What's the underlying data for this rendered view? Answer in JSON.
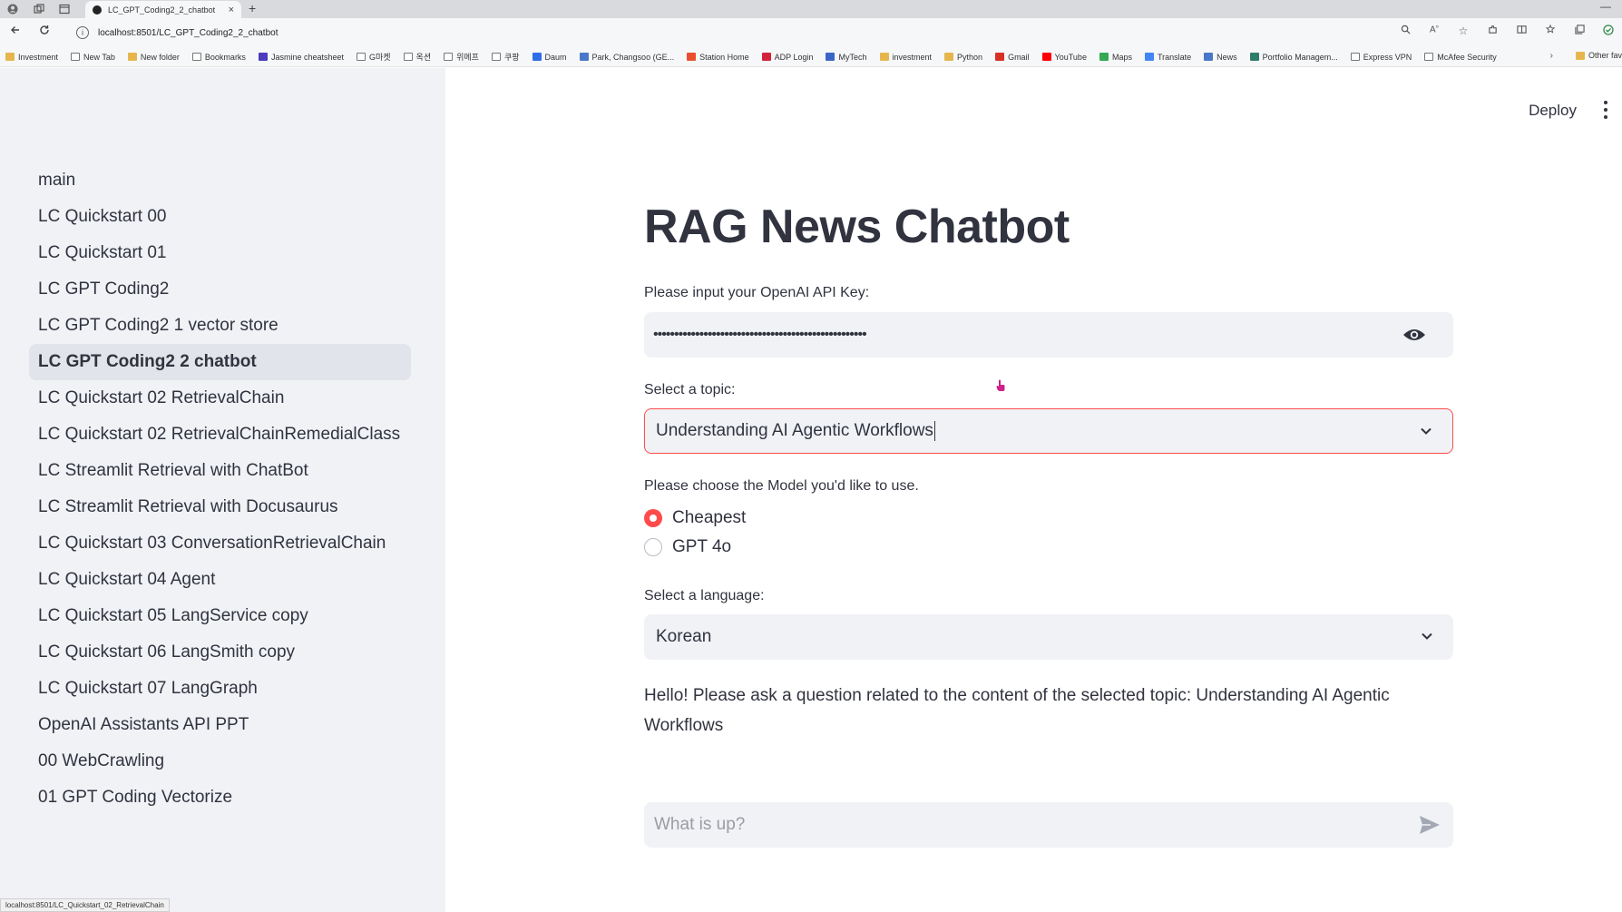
{
  "browser": {
    "tab_title": "LC_GPT_Coding2_2_chatbot",
    "tab_close": "×",
    "new_tab": "+",
    "minimize": "—",
    "url": "localhost:8501/LC_GPT_Coding2_2_chatbot",
    "status_url": "localhost:8501/LC_Quickstart_02_RetrievalChain",
    "bookmarks": [
      {
        "label": "Investment",
        "icon": "folder-icon",
        "color": "#e6b64d"
      },
      {
        "label": "New Tab",
        "icon": "page-icon",
        "color": "#ffffff"
      },
      {
        "label": "New folder",
        "icon": "folder-icon",
        "color": "#e6b64d"
      },
      {
        "label": "Bookmarks",
        "icon": "page-icon",
        "color": "#ffffff"
      },
      {
        "label": "Jasmine cheatsheet",
        "icon": "app-icon",
        "color": "#4b3bbd"
      },
      {
        "label": "G마켓",
        "icon": "page-icon",
        "color": "#ffffff"
      },
      {
        "label": "옥션",
        "icon": "page-icon",
        "color": "#ffffff"
      },
      {
        "label": "위메프",
        "icon": "page-icon",
        "color": "#ffffff"
      },
      {
        "label": "쿠팡",
        "icon": "page-icon",
        "color": "#ffffff"
      },
      {
        "label": "Daum",
        "icon": "daum-icon",
        "color": "#2f6ee5"
      },
      {
        "label": "Park, Changsoo (GE...",
        "icon": "globe-icon",
        "color": "#4a78c9"
      },
      {
        "label": "Station Home",
        "icon": "grid-icon",
        "color": "#e84f2f"
      },
      {
        "label": "ADP Login",
        "icon": "adp-icon",
        "color": "#d4213c"
      },
      {
        "label": "MyTech",
        "icon": "globe-icon",
        "color": "#3a66c8"
      },
      {
        "label": "investment",
        "icon": "folder-icon",
        "color": "#e6b64d"
      },
      {
        "label": "Python",
        "icon": "folder-icon",
        "color": "#e6b64d"
      },
      {
        "label": "Gmail",
        "icon": "gmail-icon",
        "color": "#d93025"
      },
      {
        "label": "YouTube",
        "icon": "youtube-icon",
        "color": "#ff0000"
      },
      {
        "label": "Maps",
        "icon": "maps-icon",
        "color": "#34a853"
      },
      {
        "label": "Translate",
        "icon": "translate-icon",
        "color": "#4285f4"
      },
      {
        "label": "News",
        "icon": "globe-icon",
        "color": "#4a78c9"
      },
      {
        "label": "Portfolio Managem...",
        "icon": "globe-icon",
        "color": "#2e7d6a"
      },
      {
        "label": "Express VPN",
        "icon": "page-icon",
        "color": "#ffffff"
      },
      {
        "label": "McAfee Security",
        "icon": "page-icon",
        "color": "#ffffff"
      }
    ],
    "bookmarks_more": "›",
    "other_bookmarks": "Other fav"
  },
  "sidebar": {
    "items": [
      {
        "label": "main"
      },
      {
        "label": "LC Quickstart 00"
      },
      {
        "label": "LC Quickstart 01"
      },
      {
        "label": "LC GPT Coding2"
      },
      {
        "label": "LC GPT Coding2 1 vector store"
      },
      {
        "label": "LC GPT Coding2 2 chatbot",
        "active": true
      },
      {
        "label": "LC Quickstart 02 RetrievalChain"
      },
      {
        "label": "LC Quickstart 02 RetrievalChainRemedialClass"
      },
      {
        "label": "LC Streamlit Retrieval with ChatBot"
      },
      {
        "label": "LC Streamlit Retrieval with Docusaurus"
      },
      {
        "label": "LC Quickstart 03 ConversationRetrievalChain"
      },
      {
        "label": "LC Quickstart 04 Agent"
      },
      {
        "label": "LC Quickstart 05 LangService copy"
      },
      {
        "label": "LC Quickstart 06 LangSmith copy"
      },
      {
        "label": "LC Quickstart 07 LangGraph"
      },
      {
        "label": "OpenAI Assistants API PPT"
      },
      {
        "label": "00 WebCrawling"
      },
      {
        "label": "01 GPT Coding Vectorize"
      }
    ]
  },
  "header": {
    "deploy_label": "Deploy"
  },
  "main": {
    "title": "RAG News Chatbot",
    "api_key_label": "Please input your OpenAI API Key:",
    "api_key_value": "•••••••••••••••••••••••••••••••••••••••••••••••••••",
    "topic_label": "Select a topic:",
    "topic_value": "Understanding AI Agentic Workflows",
    "model_label": "Please choose the Model you'd like to use.",
    "model_options": [
      {
        "label": "Cheapest",
        "selected": true
      },
      {
        "label": "GPT 4o",
        "selected": false
      }
    ],
    "language_label": "Select a language:",
    "language_value": "Korean",
    "greeting": "Hello! Please ask a question related to the content of the selected topic: Understanding AI Agentic Workflows",
    "chat_placeholder": "What is up?"
  },
  "colors": {
    "accent": "#ff4b4b",
    "sidebar_bg": "#f0f2f6",
    "text": "#31333f",
    "cursor": "#d0208a"
  }
}
